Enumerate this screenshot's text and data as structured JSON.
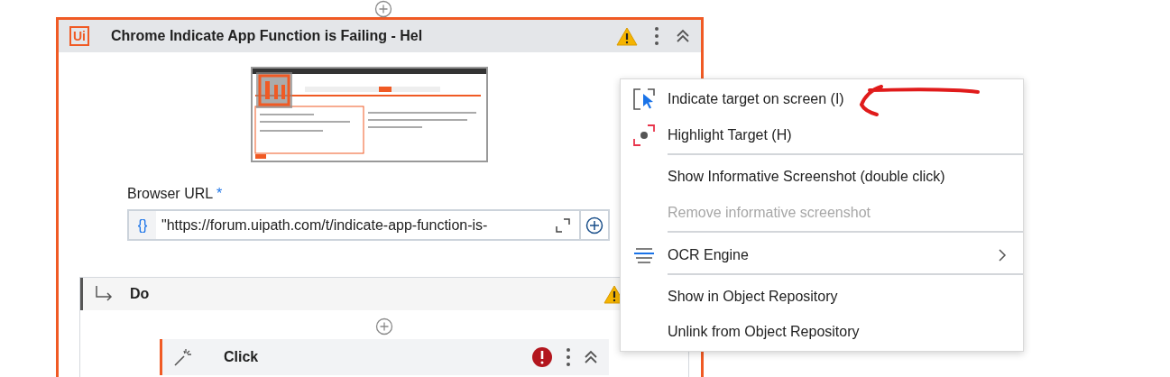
{
  "activity": {
    "logo": "Ui",
    "title": "Chrome Indicate App Function is Failing - Hel",
    "warning": true
  },
  "browser_url": {
    "label": "Browser URL",
    "required": "*",
    "prefix": "{}",
    "value": "\"https://forum.uipath.com/t/indicate-app-function-is-"
  },
  "do": {
    "title": "Do",
    "warning": true,
    "child": {
      "title": "Click",
      "error": true
    }
  },
  "context_menu": {
    "items": [
      {
        "label": "Indicate target on screen (I)",
        "kind": "cursor",
        "disabled": false,
        "separator_after": false,
        "submenu": false
      },
      {
        "label": "Highlight Target (H)",
        "kind": "highlight",
        "disabled": false,
        "separator_after": true,
        "submenu": false
      },
      {
        "label": "Show Informative Screenshot (double click)",
        "kind": "plain",
        "disabled": false,
        "separator_after": false,
        "submenu": false
      },
      {
        "label": "Remove informative screenshot",
        "kind": "plain",
        "disabled": true,
        "separator_after": true,
        "submenu": false
      },
      {
        "label": "OCR Engine",
        "kind": "ocr",
        "disabled": false,
        "separator_after": true,
        "submenu": true
      },
      {
        "label": "Show in Object Repository",
        "kind": "plain",
        "disabled": false,
        "separator_after": false,
        "submenu": false
      },
      {
        "label": "Unlink from Object Repository",
        "kind": "plain",
        "disabled": false,
        "separator_after": false,
        "submenu": false
      }
    ]
  }
}
